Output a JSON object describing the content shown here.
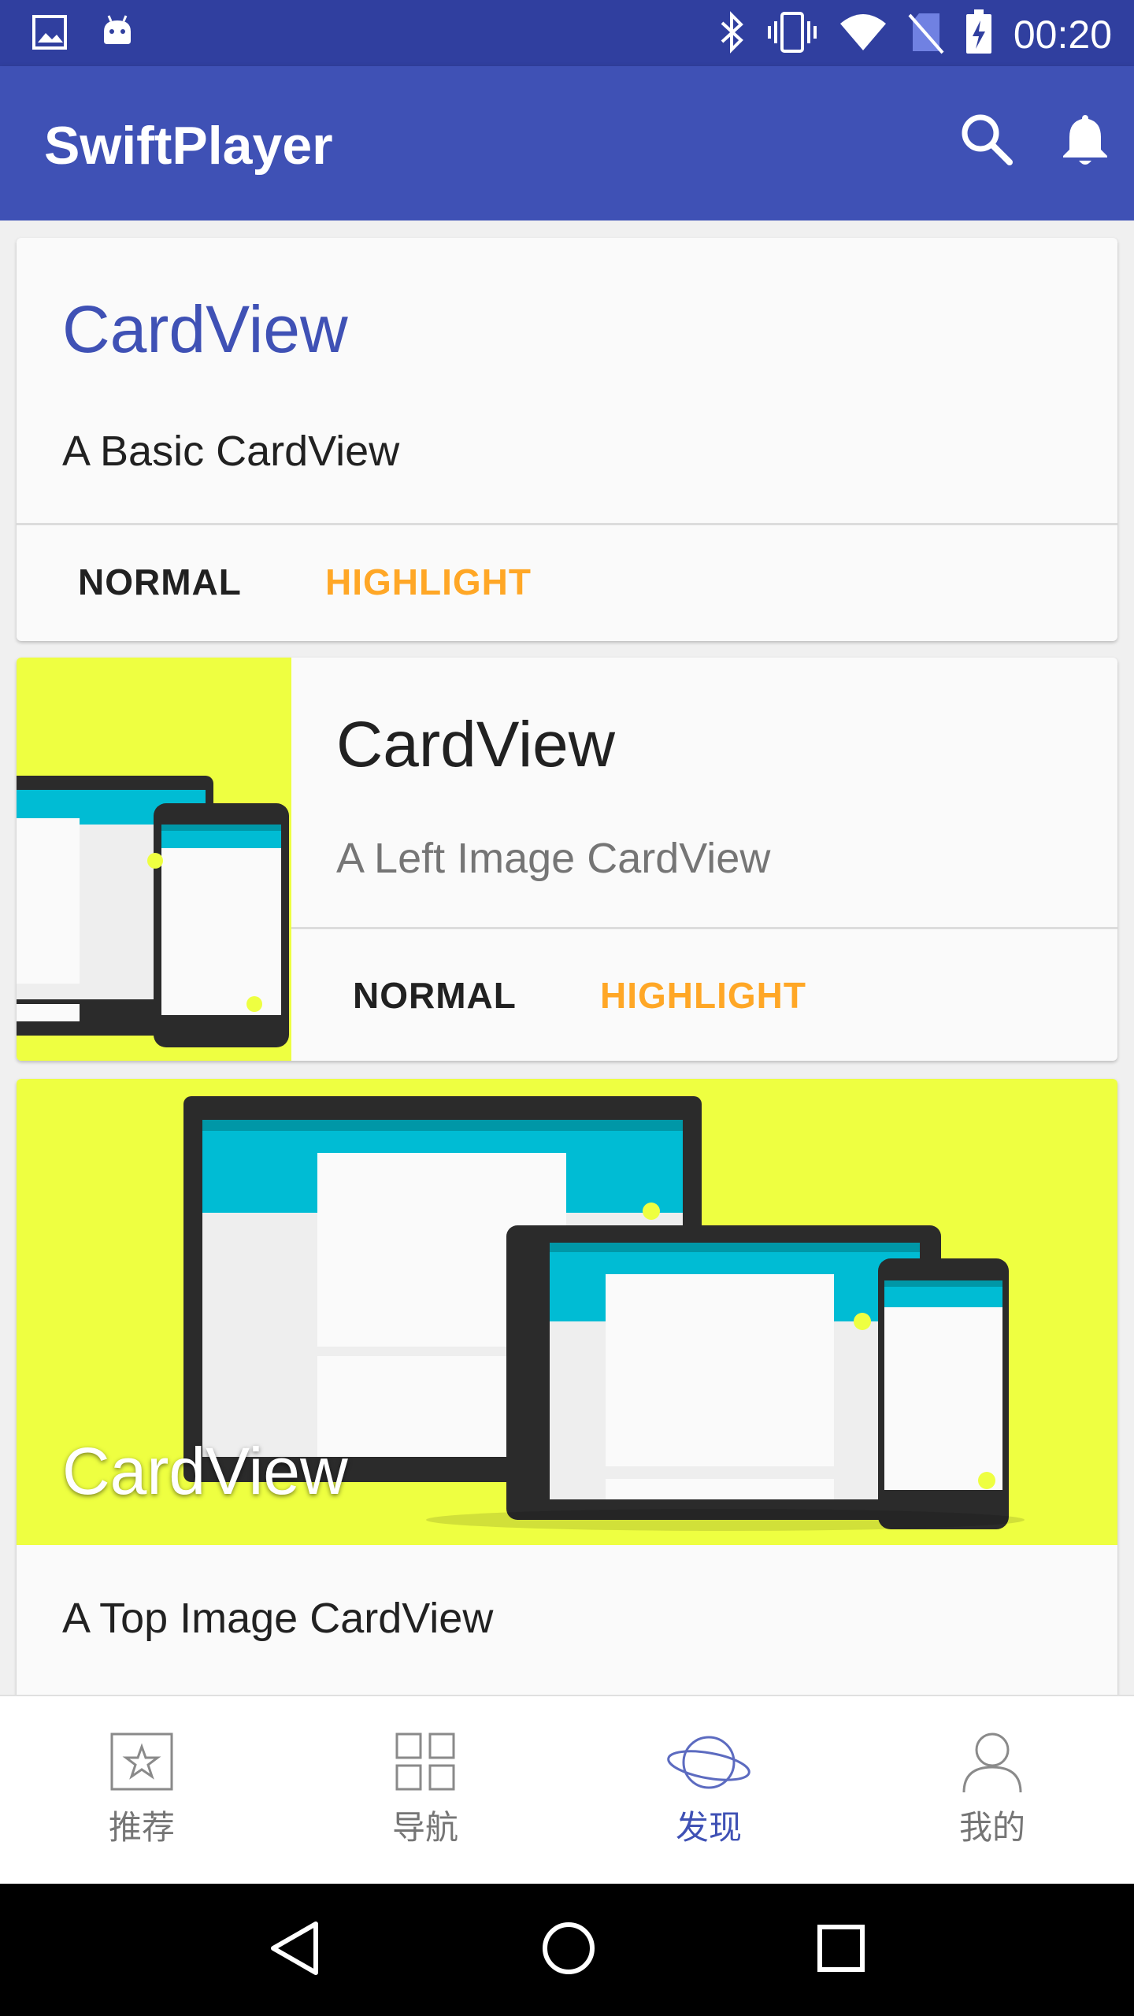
{
  "status_bar": {
    "time": "00:20",
    "left_icons": [
      "image-icon",
      "android-icon"
    ],
    "right_icons": [
      "bluetooth-icon",
      "vibrate-icon",
      "wifi-icon",
      "no-sim-icon",
      "battery-charging-icon"
    ]
  },
  "app_bar": {
    "title": "SwiftPlayer",
    "actions": [
      "search-icon",
      "bell-icon"
    ]
  },
  "cards": {
    "basic": {
      "title": "CardView",
      "subtitle": "A Basic CardView",
      "normal_label": "NORMAL",
      "highlight_label": "HIGHLIGHT"
    },
    "left_image": {
      "title": "CardView",
      "subtitle": "A Left Image CardView",
      "normal_label": "NORMAL",
      "highlight_label": "HIGHLIGHT"
    },
    "top_image": {
      "overlay_title": "CardView",
      "subtitle": "A Top Image CardView"
    }
  },
  "bottom_nav": {
    "items": [
      {
        "label": "推荐",
        "icon": "star-box-icon"
      },
      {
        "label": "导航",
        "icon": "grid-icon"
      },
      {
        "label": "发现",
        "icon": "planet-icon"
      },
      {
        "label": "我的",
        "icon": "person-icon"
      }
    ],
    "active_label": "发现"
  },
  "system_nav": [
    "back-icon",
    "home-icon",
    "recents-icon"
  ],
  "colors": {
    "primary": "#3f51b5",
    "primary_dark": "#303f9f",
    "accent_highlight": "#ffa726",
    "image_background": "#eeff41",
    "screen_cyan": "#00bcd4"
  }
}
